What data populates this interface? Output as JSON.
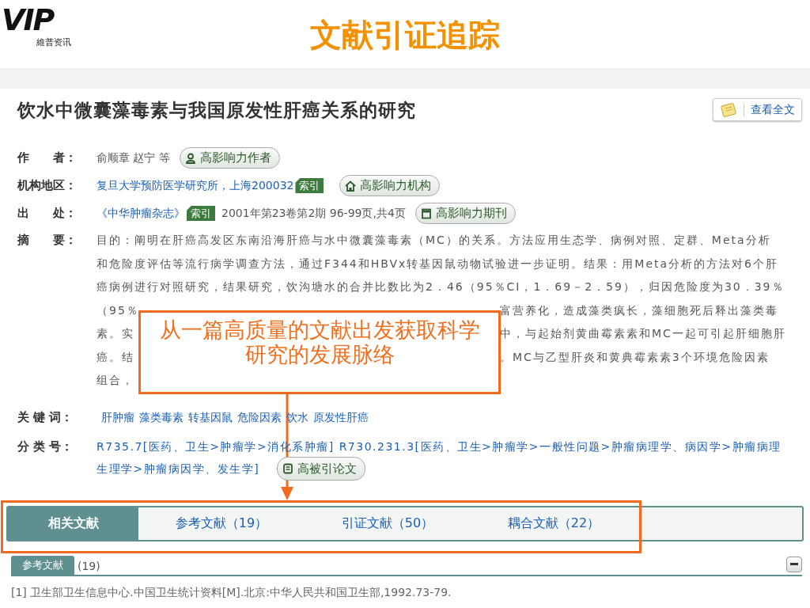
{
  "logo": {
    "mark": "VIP",
    "caption": "維普资讯"
  },
  "slide_title": "文献引证追踪",
  "article": {
    "title": "饮水中微囊藻毒素与我国原发性肝癌关系的研究",
    "full_text_button": "查看全文"
  },
  "fields": [
    {
      "label": "作　　者：",
      "parts": [
        {
          "kind": "text",
          "text": "俞顺章 赵宁 等"
        },
        {
          "kind": "pill",
          "text": "高影响力作者"
        }
      ]
    },
    {
      "label": "机构地区：",
      "parts": [
        {
          "kind": "link",
          "text": "复旦大学预防医学研究所，上海200032"
        },
        {
          "kind": "tag",
          "text": "索引"
        },
        {
          "kind": "pill",
          "text": "高影响力机构"
        }
      ]
    },
    {
      "label": "出　　处：",
      "parts": [
        {
          "kind": "link",
          "text": "《中华肿瘤杂志》"
        },
        {
          "kind": "tag",
          "text": "索引"
        },
        {
          "kind": "text",
          "text": "2001年第23卷第2期 96-99页,共4页"
        },
        {
          "kind": "pill",
          "text": "高影响力期刊"
        }
      ]
    }
  ],
  "abstract": {
    "label": "摘　　要：",
    "lines": [
      {
        "left": "目的：阐明在肝癌高发区东南沿海肝癌与水中微囊藻毒素（MC）的关系。方法应用生态学、病例对照、定群、Meta分析"
      },
      {
        "left": "和危险度评估等流行病学调查方法，通过F344和HBVx转基因鼠动物试验进一步证明。结果：用Meta分析的方法对6个肝"
      },
      {
        "left": "癌病例进行对照研究，结果研究，饮沟塘水的合并比数比为2．46（95％CI，1．69－2．59），归因危险度为30．39％"
      },
      {
        "left": "（95％",
        "right": "富营养化，造成藻类疯长，藻细胞死后释出藻类毒"
      },
      {
        "left": "素。实",
        "right": "中，与起始剂黄曲霉素素和MC一起可引起肝细胞肝"
      },
      {
        "left": "癌。结",
        "right": "。MC与乙型肝炎和黄典霉素素3个环境危险因素"
      },
      {
        "left": "组合，"
      }
    ]
  },
  "keywords": {
    "label": "关 键 词：",
    "items": [
      "肝肿瘤",
      "藻类毒素",
      "转基因鼠",
      "危险因素",
      "饮水",
      "原发性肝癌"
    ]
  },
  "classification": {
    "label": "分 类 号：",
    "lines": [
      "R735.7[医药、卫生>肿瘤学>消化系肿瘤] R730.231.3[医药、卫生>肿瘤学>一般性问题>肿瘤病理学、病因学>肿瘤病理",
      "生理学>肿瘤病因学、发生学]"
    ],
    "pill": "高被引论文"
  },
  "tabs": [
    {
      "label": "相关文献",
      "selected": true
    },
    {
      "label": "参考文献（19）",
      "selected": false
    },
    {
      "label": "引证文献（50）",
      "selected": false
    },
    {
      "label": "耦合文献（22）",
      "selected": false
    }
  ],
  "references": {
    "header": "参考文献",
    "count": "(19)",
    "items": [
      "[1] 卫生部卫生信息中心.中国卫生统计资料[M].北京:中华人民共和国卫生部,1992.73-79."
    ]
  },
  "callout": {
    "text": "从一篇高质量的文献出发获取科学研究的发展脉络"
  }
}
